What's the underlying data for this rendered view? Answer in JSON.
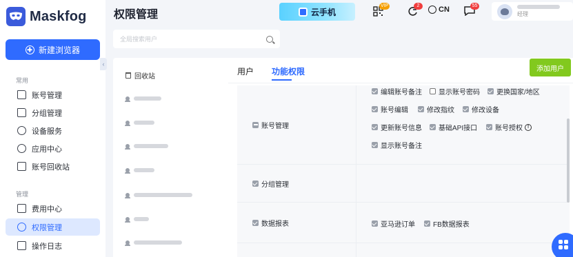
{
  "app": {
    "name": "Maskfog",
    "page_title": "权限管理"
  },
  "sidebar": {
    "new_browser_label": "新建浏览器",
    "sections": [
      {
        "label": "常用",
        "items": [
          {
            "label": "账号管理",
            "icon": "folder-icon"
          },
          {
            "label": "分组管理",
            "icon": "folder-open-icon"
          },
          {
            "label": "设备服务",
            "icon": "location-pin-icon"
          },
          {
            "label": "应用中心",
            "icon": "cube-icon"
          },
          {
            "label": "账号回收站",
            "icon": "trash-icon"
          }
        ]
      },
      {
        "label": "管理",
        "items": [
          {
            "label": "费用中心",
            "icon": "dollar-icon"
          },
          {
            "label": "权限管理",
            "icon": "shield-icon",
            "active": true
          },
          {
            "label": "操作日志",
            "icon": "log-icon"
          }
        ]
      }
    ]
  },
  "header": {
    "cloud_phone_label": "云手机",
    "notification_badge_vip": "VIP",
    "notification_badge_count": "2",
    "language": "CN",
    "message_badge_count": "55",
    "user_sub": "经理"
  },
  "user_list": {
    "search_placeholder": "全局搜索用户",
    "recycle_label": "回收站"
  },
  "main": {
    "tabs": [
      {
        "label": "用户"
      },
      {
        "label": "功能权限",
        "active": true
      }
    ],
    "add_user_label": "添加用户",
    "permission_groups": [
      {
        "name": "账号管理",
        "options": [
          {
            "label": "编辑账号备注",
            "checked": true
          },
          {
            "label": "显示账号密码",
            "checked": false
          },
          {
            "label": "更换国家/地区",
            "checked": true
          },
          {
            "label": "账号编辑",
            "checked": true
          },
          {
            "label": "修改指纹",
            "checked": true
          },
          {
            "label": "修改设备",
            "checked": true
          },
          {
            "label": "更新账号信息",
            "checked": true
          },
          {
            "label": "基础API接口",
            "checked": true
          },
          {
            "label": "账号授权",
            "checked": true,
            "info": true
          },
          {
            "label": "显示账号备注",
            "checked": true
          }
        ]
      },
      {
        "name": "分组管理",
        "options": []
      },
      {
        "name": "数据报表",
        "options": [
          {
            "label": "亚马逊订单",
            "checked": true
          },
          {
            "label": "FB数据报表",
            "checked": true
          }
        ]
      }
    ]
  },
  "colors": {
    "accent": "#2f6bff",
    "add_user_green": "#82c91e",
    "active_nav_bg": "#dde8ff"
  }
}
